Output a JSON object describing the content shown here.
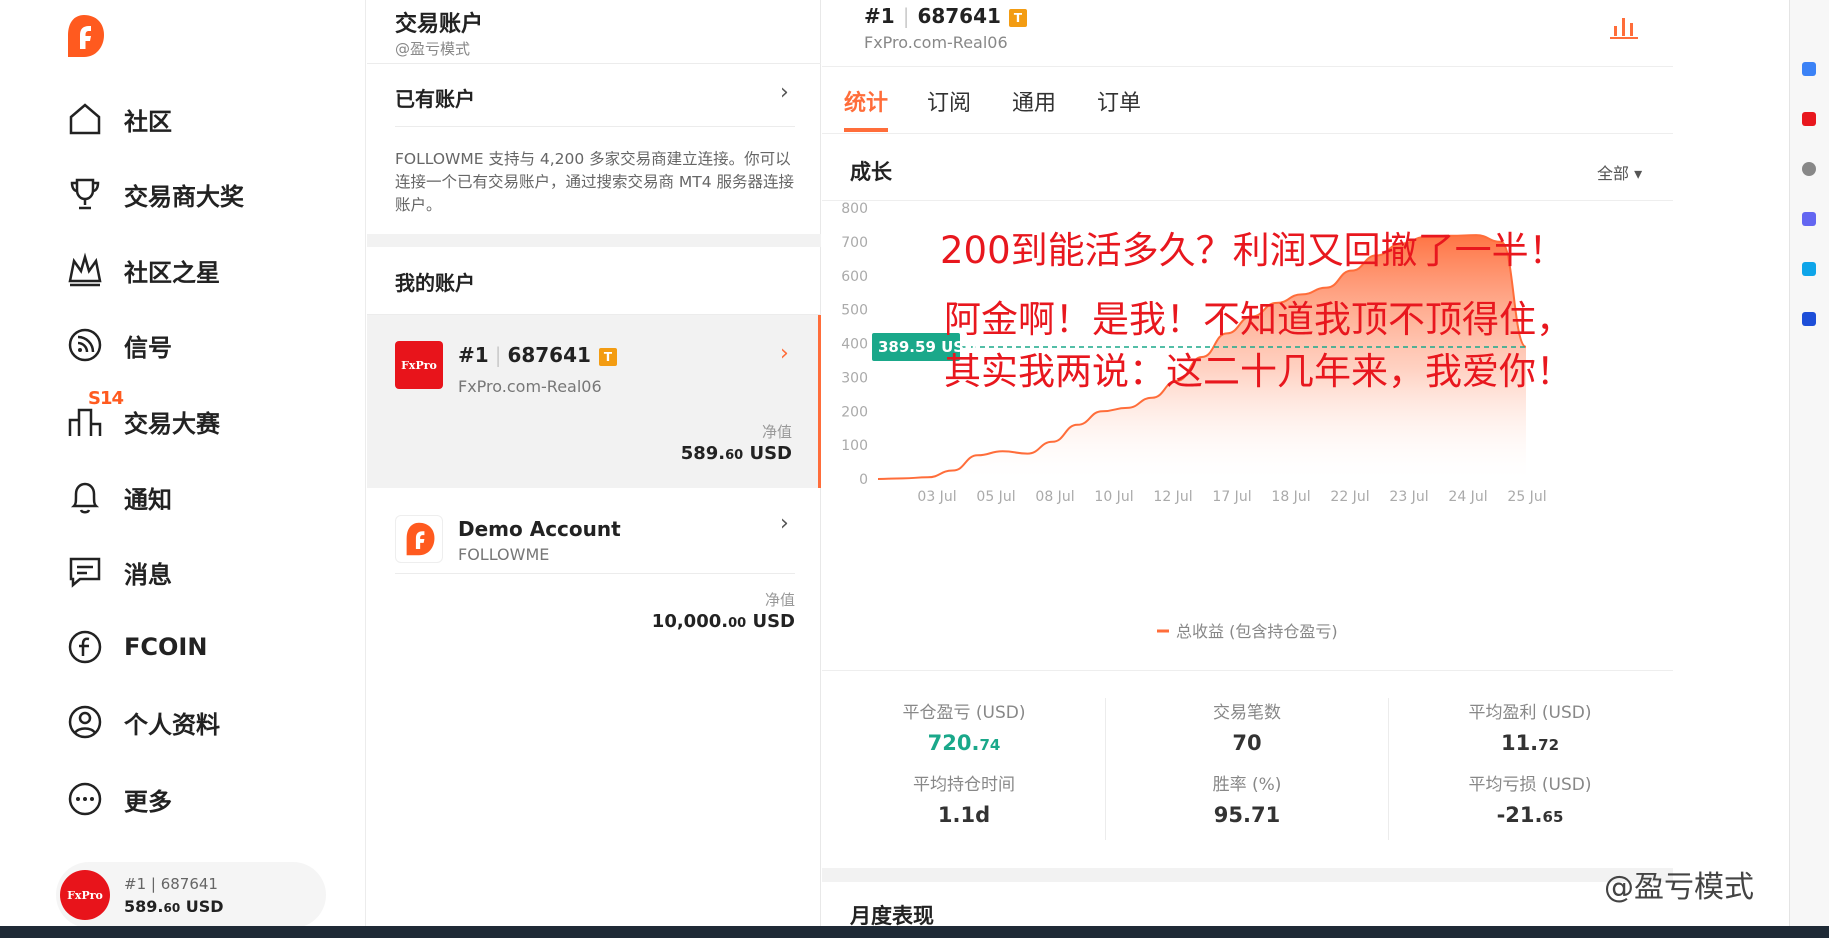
{
  "nav": {
    "items": [
      {
        "label": "社区",
        "icon": "home-icon"
      },
      {
        "label": "交易商大奖",
        "icon": "trophy-icon"
      },
      {
        "label": "社区之星",
        "icon": "crown-icon"
      },
      {
        "label": "信号",
        "icon": "signal-icon"
      },
      {
        "label": "交易大赛",
        "icon": "podium-icon"
      },
      {
        "label": "通知",
        "icon": "bell-icon"
      },
      {
        "label": "消息",
        "icon": "message-icon"
      },
      {
        "label": "FCOIN",
        "icon": "fcoin-icon"
      },
      {
        "label": "个人资料",
        "icon": "user-icon"
      },
      {
        "label": "更多",
        "icon": "more-icon"
      }
    ],
    "contest_badge": "S14",
    "account_pill": {
      "id": "#1 | 687641",
      "equity_main": "589.",
      "equity_dec": "60",
      "currency": " USD",
      "logo_text": "FxPro"
    }
  },
  "middle": {
    "title": "交易账户",
    "handle": "@盈亏模式",
    "existing_label": "已有账户",
    "description": "FOLLOWME 支持与 4,200 多家交易商建立连接。你可以连接一个已有交易账户，通过搜索交易商 MT4 服务器连接账户。",
    "my_accounts_label": "我的账户",
    "accounts": [
      {
        "num": "#1",
        "id": "687641",
        "badge": "T",
        "server": "FxPro.com-Real06",
        "equity_label": "净值",
        "equity_main": "589.",
        "equity_dec": "60",
        "currency": " USD",
        "logo_text": "FxPro"
      },
      {
        "name": "Demo Account",
        "server": "FOLLOWME",
        "equity_label": "净值",
        "equity_main": "10,000.",
        "equity_dec": "00",
        "currency": " USD"
      }
    ]
  },
  "right": {
    "account_num": "#1",
    "account_id": "687641",
    "badge": "T",
    "server": "FxPro.com-Real06",
    "tabs": [
      "统计",
      "订阅",
      "通用",
      "订单"
    ],
    "growth_title": "成长",
    "growth_filter": "全部 ▾",
    "monthly_title": "月度表现",
    "stats": [
      {
        "label": "平仓盈亏 (USD)",
        "main": "720.",
        "dec": "74",
        "green": true
      },
      {
        "label": "交易笔数",
        "main": "70",
        "dec": ""
      },
      {
        "label": "平均盈利 (USD)",
        "main": "11.",
        "dec": "72"
      },
      {
        "label": "平均持仓时间",
        "main": "1.1d",
        "dec": ""
      },
      {
        "label": "胜率 (%)",
        "main": "95.71",
        "dec": ""
      },
      {
        "label": "平均亏损 (USD)",
        "main": "-21.",
        "dec": "65"
      }
    ]
  },
  "overlay": {
    "line1": "200到能活多久？利润又回撤了一半！",
    "line2": "阿金啊！是我！不知道我顶不顶得住，",
    "line3": "其实我两说：这二十几年来，我爱你！"
  },
  "watermark": "@盈亏模式",
  "colors": {
    "accent": "#ff6d3a",
    "green": "#1aa88a",
    "red": "#e8171e"
  },
  "chart_data": {
    "type": "area",
    "title": "",
    "x": [
      "01 Jul",
      "02 Jul",
      "03 Jul",
      "04 Jul",
      "05 Jul",
      "06 Jul",
      "07 Jul",
      "08 Jul",
      "09 Jul",
      "10 Jul",
      "11 Jul",
      "12 Jul",
      "13 Jul",
      "14 Jul",
      "15 Jul",
      "16 Jul",
      "17 Jul",
      "17.5 Jul",
      "18 Jul",
      "19 Jul",
      "20 Jul",
      "21 Jul",
      "22 Jul",
      "23 Jul",
      "24 Jul",
      "24.3 Jul",
      "25 Jul"
    ],
    "x_ticks": [
      "03 Jul",
      "05 Jul",
      "08 Jul",
      "10 Jul",
      "12 Jul",
      "17 Jul",
      "18 Jul",
      "22 Jul",
      "23 Jul",
      "24 Jul",
      "25 Jul"
    ],
    "series": [
      {
        "name": "总收益 (包含持仓盈亏)",
        "values": [
          0,
          2,
          5,
          25,
          70,
          82,
          75,
          110,
          160,
          200,
          210,
          240,
          290,
          360,
          430,
          480,
          520,
          545,
          565,
          615,
          660,
          695,
          715,
          718,
          720,
          700,
          390
        ]
      }
    ],
    "ylim": [
      0,
      800
    ],
    "y_ticks": [
      0,
      100,
      200,
      300,
      400,
      500,
      600,
      700,
      800
    ],
    "marker": {
      "value": 389.59,
      "label": "389.59 USD"
    },
    "legend": "bottom-center",
    "grid": false
  }
}
